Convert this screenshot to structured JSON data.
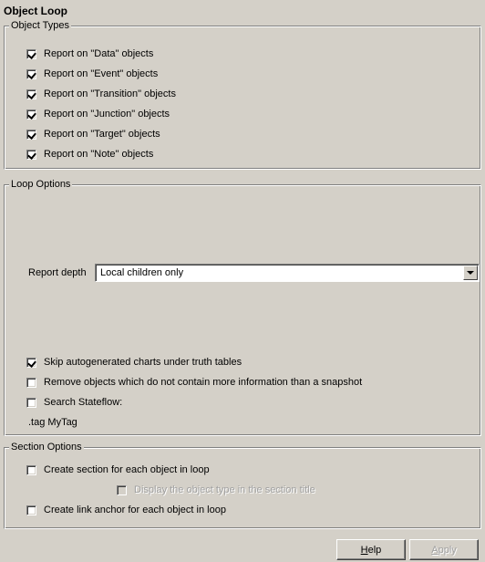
{
  "panel_title": "Object Loop",
  "object_types": {
    "legend": "Object Types",
    "items": [
      {
        "label": "Report on \"Data\" objects",
        "checked": true
      },
      {
        "label": "Report on \"Event\" objects",
        "checked": true
      },
      {
        "label": "Report on \"Transition\" objects",
        "checked": true
      },
      {
        "label": "Report on \"Junction\" objects",
        "checked": true
      },
      {
        "label": "Report on \"Target\" objects",
        "checked": true
      },
      {
        "label": "Report on \"Note\" objects",
        "checked": true
      }
    ]
  },
  "loop_options": {
    "legend": "Loop Options",
    "report_depth_label": "Report depth",
    "report_depth_value": "Local children only",
    "skip_autogenerated": {
      "label": "Skip autogenerated charts under truth tables",
      "checked": true
    },
    "remove_objects": {
      "label": "Remove objects which do not contain more information than a snapshot",
      "checked": false
    },
    "search_stateflow": {
      "label": "Search Stateflow:",
      "checked": false
    },
    "search_text": ".tag MyTag"
  },
  "section_options": {
    "legend": "Section Options",
    "create_section": {
      "label": "Create section for each object in loop",
      "checked": false
    },
    "display_object_type": {
      "label": "Display the object type in the section title",
      "checked": false,
      "disabled": true
    },
    "create_link_anchor": {
      "label": "Create link anchor for each object in loop",
      "checked": false
    }
  },
  "buttons": {
    "help_mnemonic": "H",
    "help_rest": "elp",
    "apply_mnemonic": "A",
    "apply_rest": "pply",
    "apply_disabled": true
  }
}
